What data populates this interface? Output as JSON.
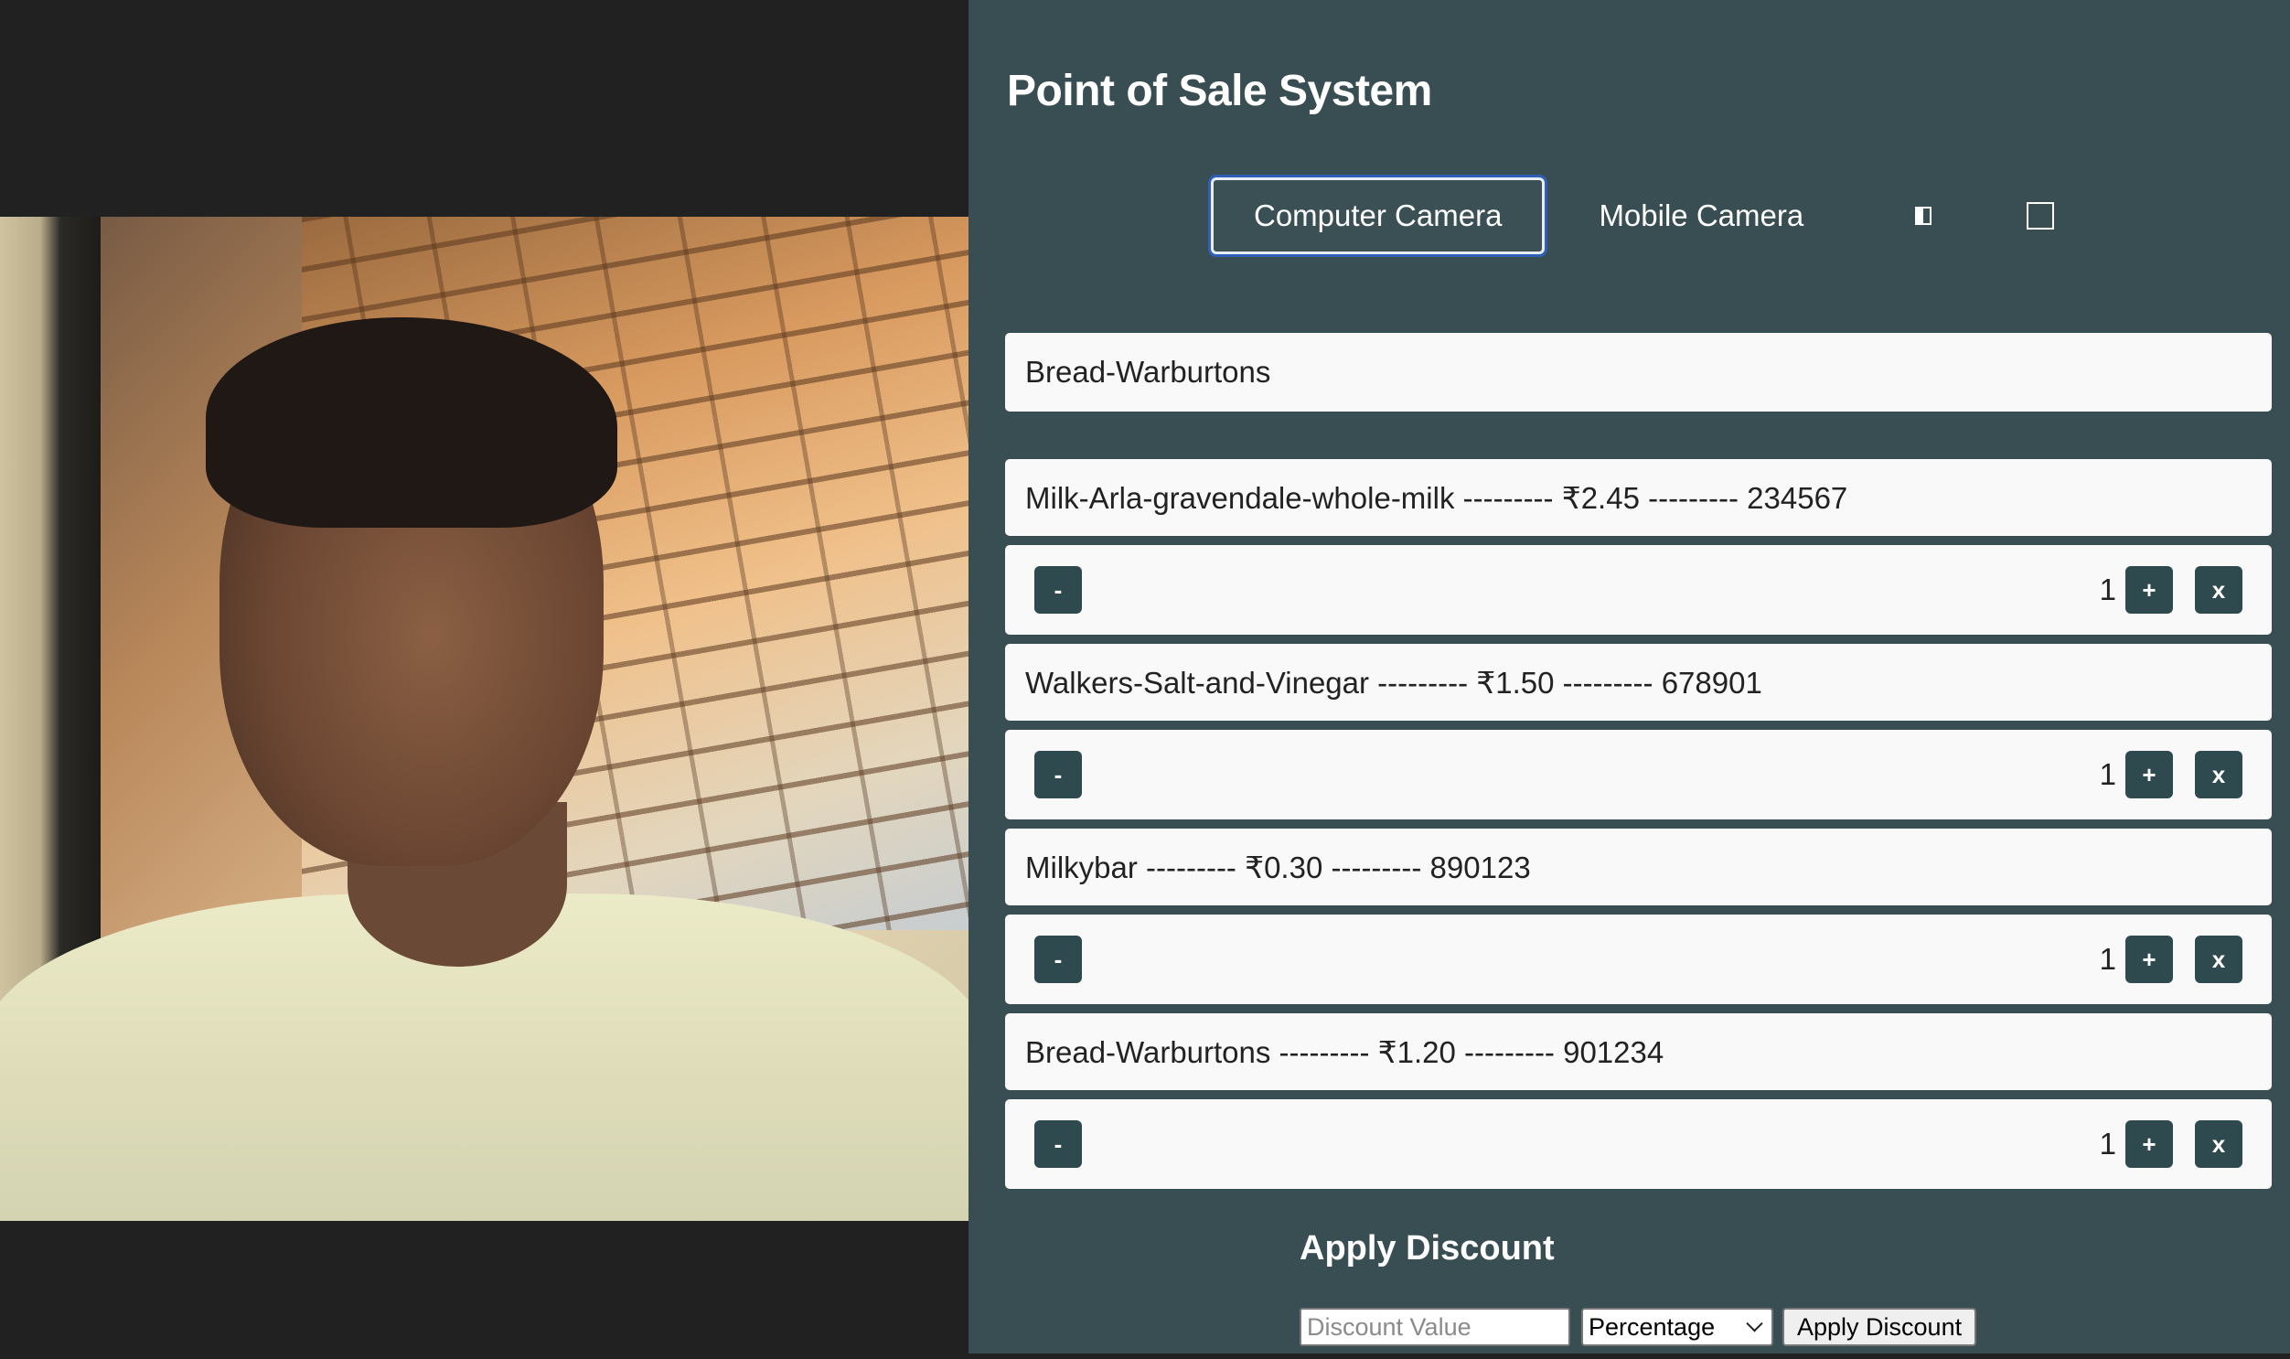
{
  "header": {
    "title": "Point of Sale System"
  },
  "camera_tabs": {
    "computer_camera": "Computer Camera",
    "mobile_camera": "Mobile Camera",
    "active": "Computer Camera"
  },
  "icons": {
    "toggle_icon": "half-square-icon",
    "fullscreen_icon": "square-icon"
  },
  "scan_display": {
    "value": "Bread-Warburtons"
  },
  "items": [
    {
      "label": "Milk-Arla-gravendale-whole-milk --------- ₹2.45 --------- 234567",
      "qty": "1"
    },
    {
      "label": "Walkers-Salt-and-Vinegar --------- ₹1.50 --------- 678901",
      "qty": "1"
    },
    {
      "label": "Milkybar --------- ₹0.30 --------- 890123",
      "qty": "1"
    },
    {
      "label": "Bread-Warburtons --------- ₹1.20 --------- 901234",
      "qty": "1"
    }
  ],
  "controls": {
    "decrement": "-",
    "increment": "+",
    "remove": "x"
  },
  "discount": {
    "title": "Apply Discount",
    "input_placeholder": "Discount Value",
    "type_selected": "Percentage",
    "apply_label": "Apply Discount"
  },
  "colors": {
    "panel_bg": "#384e52",
    "button_bg": "#2f4a4e",
    "left_bg": "#212121"
  }
}
